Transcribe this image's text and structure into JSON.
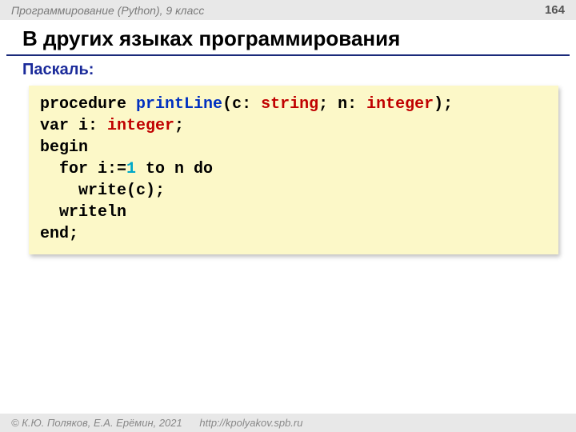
{
  "header": {
    "course": "Программирование (Python), 9 класс",
    "page": "164"
  },
  "title": "В других языках программирования",
  "subtitle": "Паскаль:",
  "code": {
    "l1a": "procedure ",
    "l1b": "printLine",
    "l1c": "(c: ",
    "l1d": "string",
    "l1e": "; n: ",
    "l1f": "integer",
    "l1g": ");",
    "l2a": "var i: ",
    "l2b": "integer",
    "l2c": ";",
    "l3": "begin",
    "l4a": "  for i:=",
    "l4b": "1",
    "l4c": " to n do",
    "l5": "    write(c);",
    "l6": "  writeln",
    "l7": "end;"
  },
  "footer": {
    "copyright": "© К.Ю. Поляков, Е.А. Ерёмин, 2021",
    "url": "http://kpolyakov.spb.ru"
  }
}
